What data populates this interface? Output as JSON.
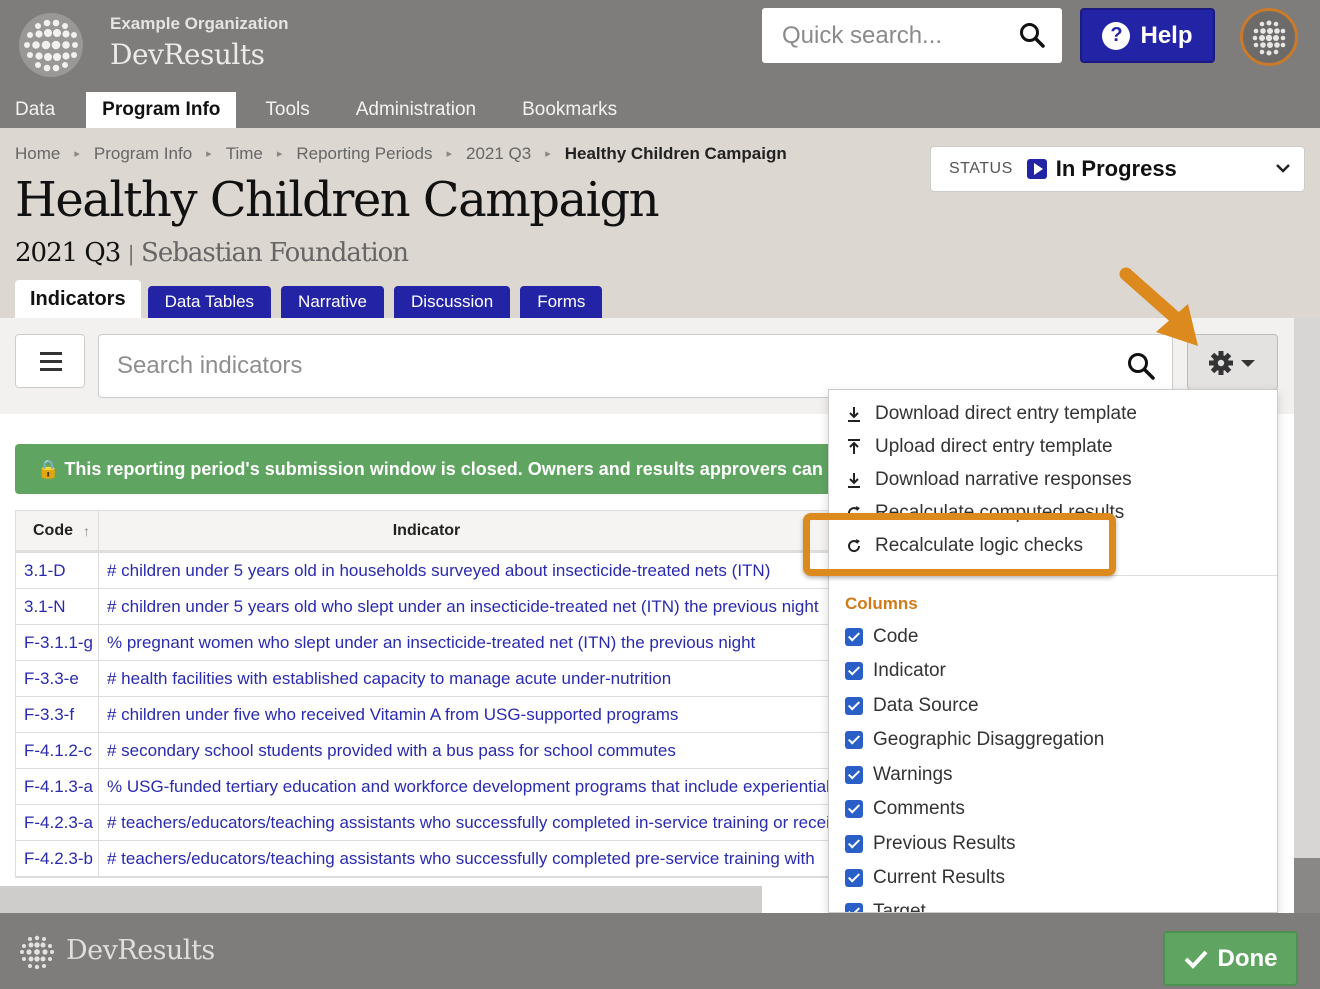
{
  "header": {
    "org_name": "Example Organization",
    "app_name": "DevResults",
    "search_placeholder": "Quick search...",
    "help_label": "Help"
  },
  "nav": [
    "Data",
    "Program Info",
    "Tools",
    "Administration",
    "Bookmarks"
  ],
  "breadcrumb": [
    "Home",
    "Program Info",
    "Time",
    "Reporting Periods",
    "2021 Q3",
    "Healthy Children Campaign"
  ],
  "page": {
    "title": "Healthy Children Campaign",
    "period": "2021 Q3",
    "org": "Sebastian Foundation"
  },
  "status": {
    "label": "STATUS",
    "value": "In Progress"
  },
  "tabs": [
    "Indicators",
    "Data Tables",
    "Narrative",
    "Discussion",
    "Forms"
  ],
  "toolbar": {
    "search_placeholder": "Search indicators"
  },
  "alert": "🔒 This reporting period's submission window is closed. Owners and results approvers can",
  "table": {
    "columns": [
      "Code",
      "Indicator"
    ],
    "rows": [
      {
        "code": "3.1-D",
        "indicator": "# children under 5 years old in households surveyed about insecticide-treated nets (ITN)"
      },
      {
        "code": "3.1-N",
        "indicator": "# children under 5 years old who slept under an insecticide-treated net (ITN) the previous night"
      },
      {
        "code": "F-3.1.1-g",
        "indicator": "% pregnant women who slept under an insecticide-treated net (ITN) the previous night"
      },
      {
        "code": "F-3.3-e",
        "indicator": "# health facilities with established capacity to manage acute under-nutrition"
      },
      {
        "code": "F-3.3-f",
        "indicator": "# children under five who received Vitamin A from USG-supported programs"
      },
      {
        "code": "F-4.1.2-c",
        "indicator": "# secondary school students provided with a bus pass for school commutes"
      },
      {
        "code": "F-4.1.3-a",
        "indicator": "% USG-funded tertiary education and workforce development programs that include experiential"
      },
      {
        "code": "F-4.2.3-a",
        "indicator": "# teachers/educators/teaching assistants who successfully completed in-service training or received"
      },
      {
        "code": "F-4.2.3-b",
        "indicator": "# teachers/educators/teaching assistants who successfully completed pre-service training with"
      }
    ]
  },
  "dropdown": {
    "actions": [
      {
        "label": "Download direct entry template",
        "icon": "download-icon"
      },
      {
        "label": "Upload direct entry template",
        "icon": "upload-icon"
      },
      {
        "label": "Download narrative responses",
        "icon": "download-icon"
      },
      {
        "label": "Recalculate computed results",
        "icon": "refresh-icon"
      },
      {
        "label": "Recalculate logic checks",
        "icon": "refresh-icon"
      }
    ],
    "columns_header": "Columns",
    "columns": [
      "Code",
      "Indicator",
      "Data Source",
      "Geographic Disaggregation",
      "Warnings",
      "Comments",
      "Previous Results",
      "Current Results",
      "Target"
    ]
  },
  "footer": {
    "app_name": "DevResults",
    "done_label": "Done"
  },
  "colors": {
    "primary": "#2323a6",
    "success": "#5fa561",
    "accent": "#dc8a1d"
  }
}
